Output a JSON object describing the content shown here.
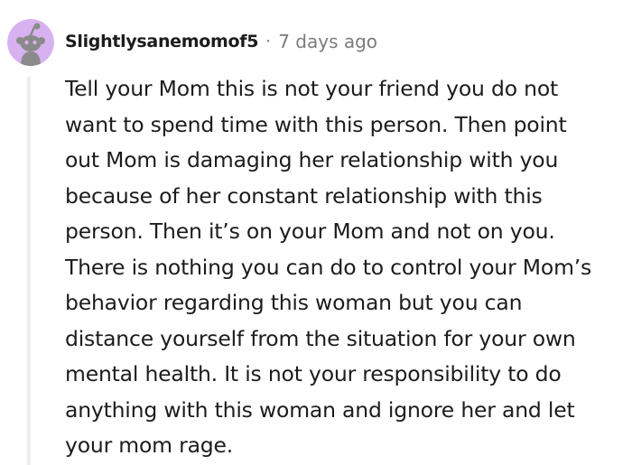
{
  "comment": {
    "author": "Slightlysanemomof5",
    "separator": "·",
    "timestamp": "7 days ago",
    "avatar_icon": "reddit-snoo-avatar-icon",
    "colors": {
      "avatar_bg": "#D8B2F0",
      "thread_line": "#EDEDED",
      "text": "#1C1C1C",
      "meta": "#7C7C7C"
    },
    "body_lines": [
      "Tell your Mom this is not your friend you do not",
      "want to spend time with this person. Then point",
      "out Mom is damaging her relationship with you",
      "because of her constant relationship with this",
      "person. Then it’s on your Mom and not on you.",
      "There is nothing you can do to control your Mom’s",
      "behavior regarding this woman but you can",
      "distance yourself from the situation for your own",
      "mental health. It is not your responsibility to do",
      "anything with this woman and ignore her and let",
      "your mom rage."
    ]
  }
}
